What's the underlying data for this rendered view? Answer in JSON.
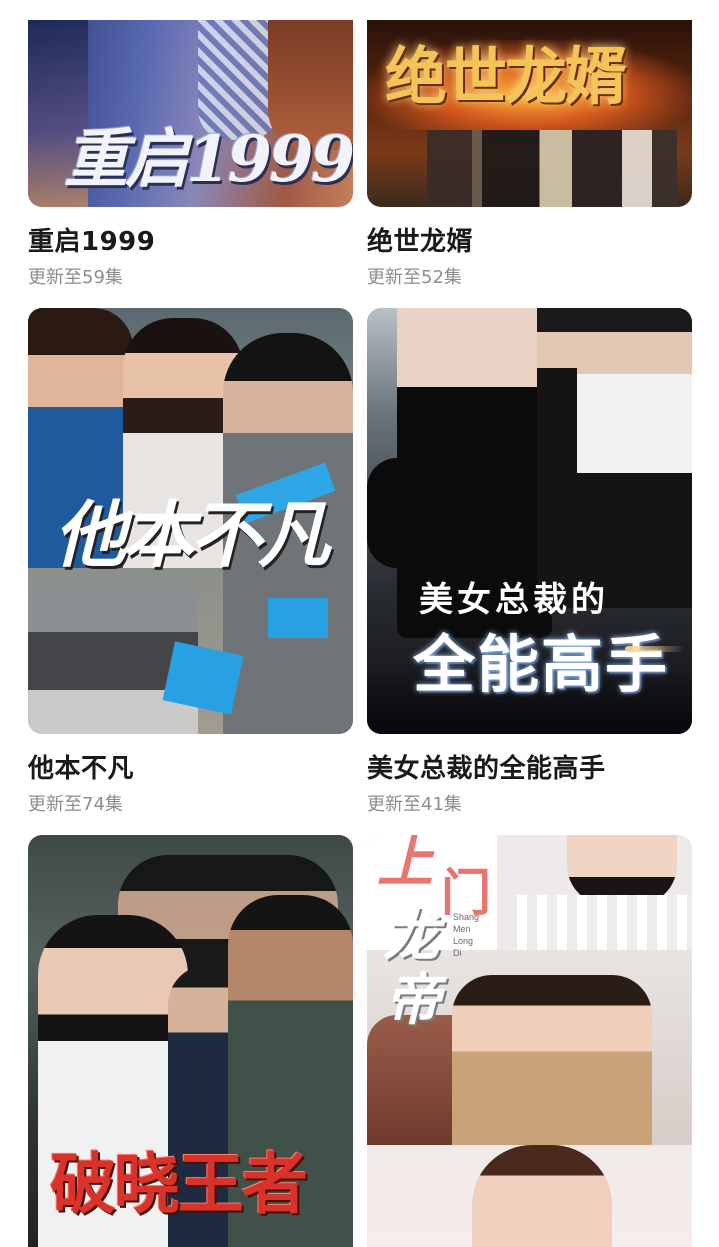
{
  "dramas": [
    {
      "title": "重启1999",
      "subtitle": "更新至59集",
      "poster_text": "重启1999"
    },
    {
      "title": "绝世龙婿",
      "subtitle": "更新至52集",
      "poster_text": "绝世龙婿"
    },
    {
      "title": "他本不凡",
      "subtitle": "更新至74集",
      "poster_text": "他本不凡"
    },
    {
      "title": "美女总裁的全能高手",
      "subtitle": "更新至41集",
      "poster_text_line1": "美女总裁的",
      "poster_text_line2": "全能高手"
    },
    {
      "title": "",
      "subtitle": "",
      "poster_text": "破晓王者"
    },
    {
      "title": "",
      "subtitle": "",
      "poster_text_chars": [
        "上",
        "门",
        "龙",
        "帝"
      ],
      "poster_pinyin": [
        "Shang",
        "Men",
        "Long",
        "Di"
      ]
    }
  ]
}
